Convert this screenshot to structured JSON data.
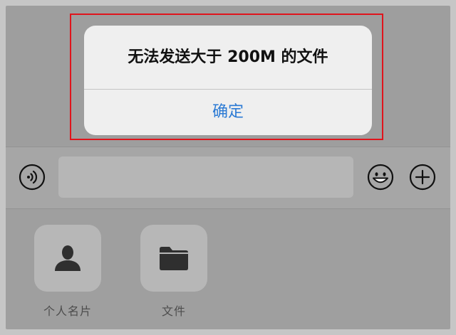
{
  "alert": {
    "message": "无法发送大于 200M 的文件",
    "confirm_label": "确定"
  },
  "input_bar": {
    "text_value": "",
    "icons": [
      "voice-icon",
      "emoji-icon",
      "plus-icon"
    ]
  },
  "panel": {
    "items": [
      {
        "label": "个人名片",
        "icon": "contact-card-icon"
      },
      {
        "label": "文件",
        "icon": "folder-icon"
      }
    ]
  },
  "colors": {
    "alert_button": "#2b7ad4",
    "highlight_border": "#e0141c",
    "alert_background": "#efefef"
  }
}
